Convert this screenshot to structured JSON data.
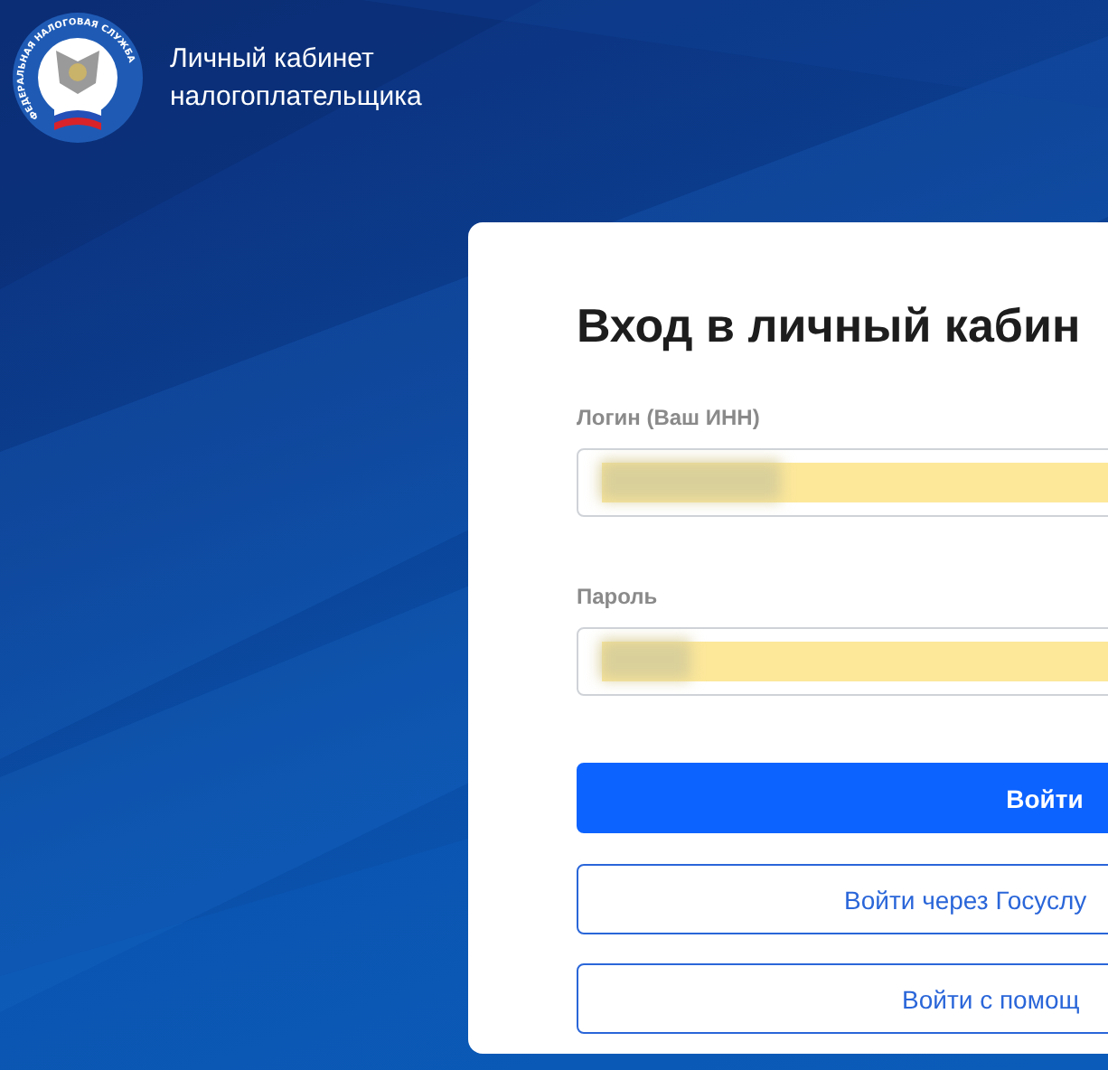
{
  "header": {
    "logo_text": "ФЕДЕРАЛЬНАЯ НАЛОГОВАЯ СЛУЖБА",
    "title_lines": [
      "Личный кабинет",
      "налогоплательщика"
    ]
  },
  "login_card": {
    "title": "Вход в личный кабин",
    "fields": [
      {
        "label": "Логин (Ваш ИНН)",
        "autofilled": true,
        "value_redacted": true
      },
      {
        "label": "Пароль",
        "autofilled": true,
        "value_redacted": true
      }
    ],
    "buttons": [
      {
        "label": "Войти",
        "kind": "primary"
      },
      {
        "label": "Войти через Госуслу",
        "kind": "outline"
      },
      {
        "label": "Войти с помощ",
        "kind": "outline"
      }
    ]
  }
}
